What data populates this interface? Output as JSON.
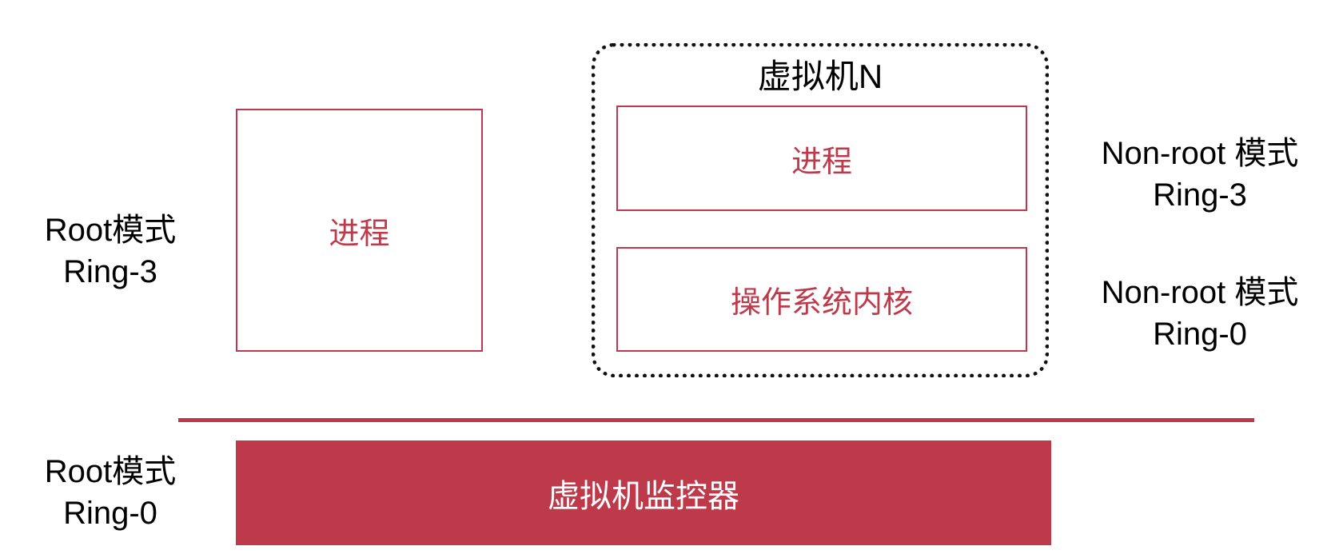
{
  "left_labels": {
    "upper": {
      "line1": "Root模式",
      "line2": "Ring-3"
    },
    "lower": {
      "line1": "Root模式",
      "line2": "Ring-0"
    }
  },
  "right_labels": {
    "upper": {
      "line1": "Non-root 模式",
      "line2": "Ring-3"
    },
    "lower": {
      "line1": "Non-root 模式",
      "line2": "Ring-0"
    }
  },
  "host_process": {
    "label": "进程"
  },
  "virtual_machine": {
    "title": "虚拟机N",
    "process_label": "进程",
    "kernel_label": "操作系统内核"
  },
  "hypervisor": {
    "label": "虚拟机监控器"
  },
  "colors": {
    "accent": "#be3a4b",
    "text": "#000000",
    "background": "#ffffff"
  }
}
